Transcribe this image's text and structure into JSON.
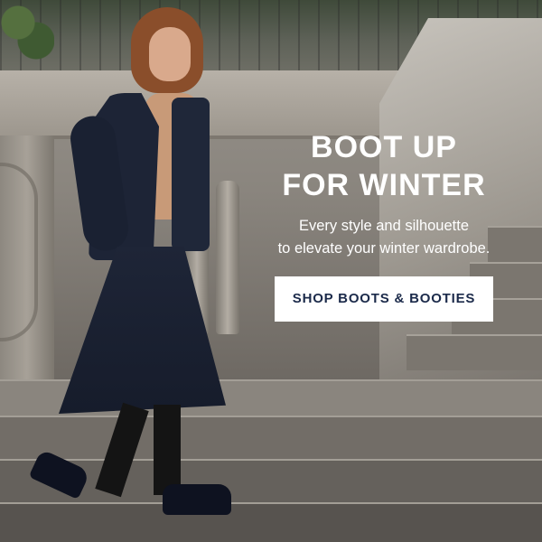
{
  "banner": {
    "headline_line1": "BOOT UP",
    "headline_line2": "FOR WINTER",
    "subtext_line1": "Every style and silhouette",
    "subtext_line2": "to elevate your winter wardrobe.",
    "cta_label": "SHOP BOOTS & BOOTIES"
  },
  "colors": {
    "headline_text": "#ffffff",
    "cta_background": "#ffffff",
    "cta_text": "#1b2a4a"
  }
}
